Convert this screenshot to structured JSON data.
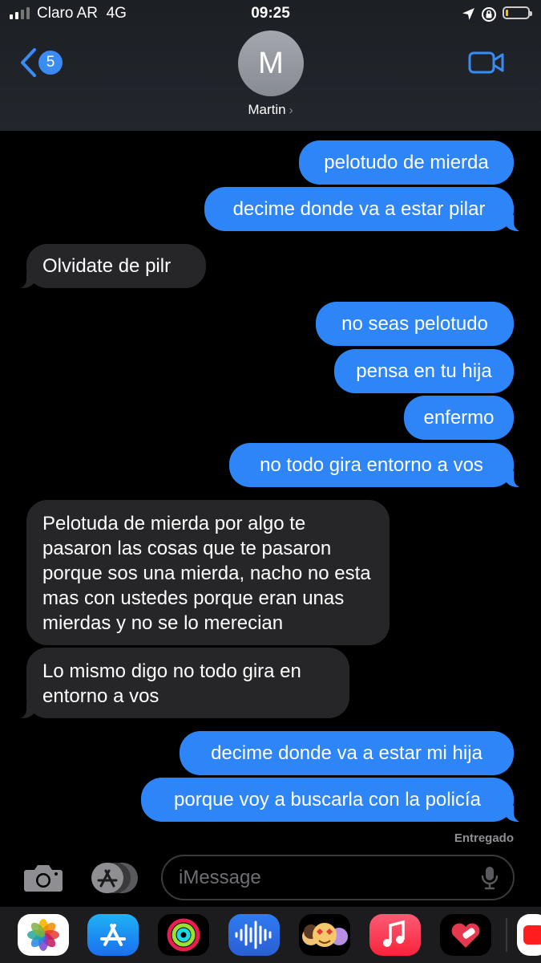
{
  "status": {
    "carrier": "Claro AR",
    "network": "4G",
    "time": "09:25"
  },
  "header": {
    "back_count": "5",
    "avatar_initial": "M",
    "contact_name": "Martin",
    "chevron": "›"
  },
  "messages": [
    {
      "from": "me",
      "text": "pelotudo de mierda"
    },
    {
      "from": "me",
      "text": "decime donde va a estar pilar"
    },
    {
      "from": "them",
      "text": "Olvidate de pilr"
    },
    {
      "from": "me",
      "text": "no seas pelotudo"
    },
    {
      "from": "me",
      "text": "pensa en tu hija"
    },
    {
      "from": "me",
      "text": "enfermo"
    },
    {
      "from": "me",
      "text": "no todo gira entorno a vos"
    },
    {
      "from": "them",
      "text": "Pelotuda de mierda por algo te pasaron las cosas que te pasaron porque sos una mierda, nacho no esta mas con ustedes porque eran unas mierdas y no se lo merecian"
    },
    {
      "from": "them",
      "text": "Lo mismo digo no todo gira en entorno a vos"
    },
    {
      "from": "me",
      "text": "decime donde va a estar mi hija"
    },
    {
      "from": "me",
      "text": "porque voy a buscarla con la policía"
    }
  ],
  "delivered": "Entregado",
  "compose": {
    "placeholder": "iMessage"
  },
  "apps": [
    "photos-icon",
    "app-store-icon",
    "activity-icon",
    "audio-message-icon",
    "memoji-icon",
    "music-icon",
    "heart-sticker-icon",
    "partial-app-icon"
  ],
  "colors": {
    "sent_bubble": "#2e85f7",
    "received_bubble": "#262628",
    "accent": "#3a8cf4"
  }
}
